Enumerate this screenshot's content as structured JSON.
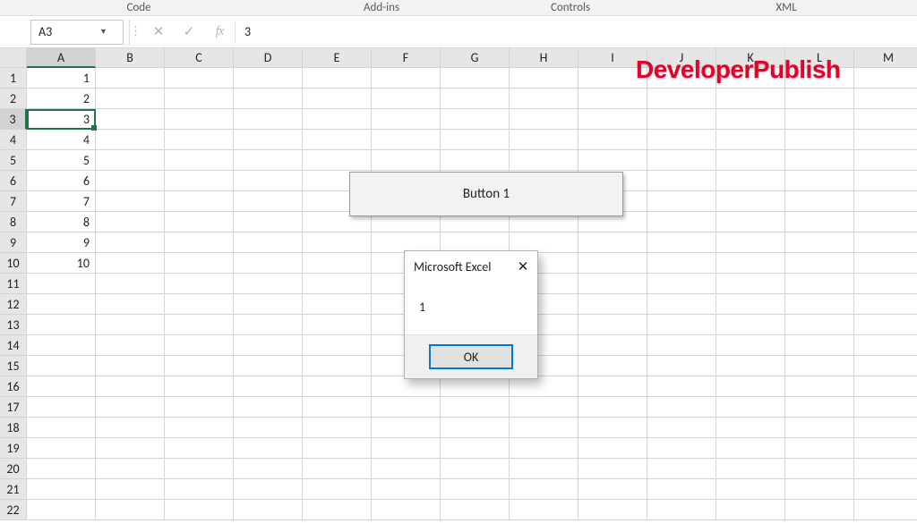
{
  "ribbon": {
    "groups": [
      "Code",
      "Add-ins",
      "Controls",
      "XML"
    ]
  },
  "nameBox": {
    "value": "A3"
  },
  "formulaBar": {
    "cancel_glyph": "✕",
    "confirm_glyph": "✓",
    "fx_label": "fx",
    "value": "3"
  },
  "columns": [
    "A",
    "B",
    "C",
    "D",
    "E",
    "F",
    "G",
    "H",
    "I",
    "J",
    "K",
    "L",
    "M"
  ],
  "rows": [
    "1",
    "2",
    "3",
    "4",
    "5",
    "6",
    "7",
    "8",
    "9",
    "10",
    "11",
    "12",
    "13",
    "14",
    "15",
    "16",
    "17",
    "18",
    "19",
    "20",
    "21",
    "22"
  ],
  "selected": {
    "col": "A",
    "row": "3"
  },
  "cellsA": {
    "1": "1",
    "2": "2",
    "3": "3",
    "4": "4",
    "5": "5",
    "6": "6",
    "7": "7",
    "8": "8",
    "9": "9",
    "10": "10"
  },
  "formButton": {
    "label": "Button 1"
  },
  "msgbox": {
    "title": "Microsoft Excel",
    "close_glyph": "✕",
    "message": "1",
    "ok_label": "OK"
  },
  "watermark": {
    "text": "DeveloperPublish"
  }
}
